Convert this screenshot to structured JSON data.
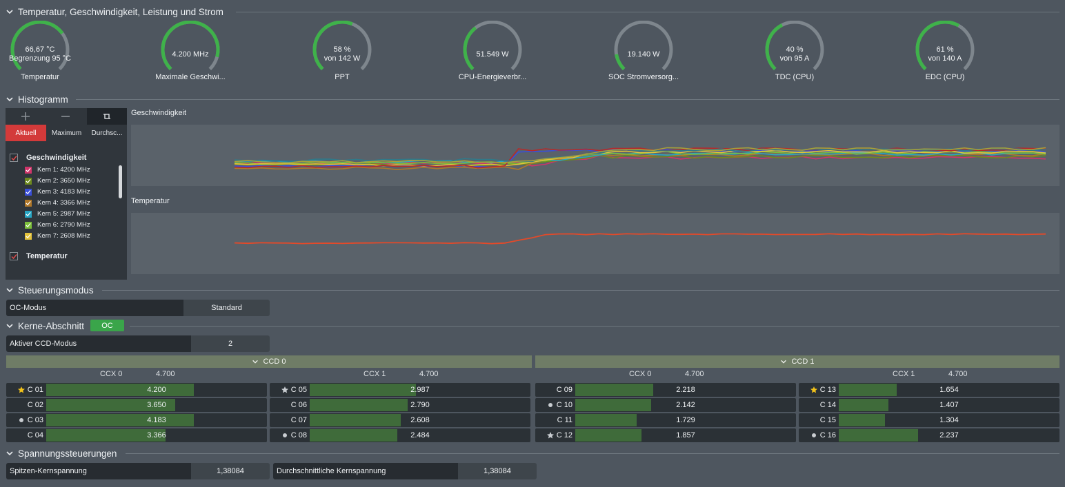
{
  "sections": {
    "temps": "Temperatur, Geschwindigkeit, Leistung und Strom",
    "histogram": "Histogramm",
    "control_mode": "Steuerungsmodus",
    "cores": "Kerne-Abschnitt",
    "voltage": "Spannungssteuerungen"
  },
  "gauges": [
    {
      "v1": "66,67 °C",
      "v2": "Begrenzung 95 °C",
      "label": "Temperatur",
      "level": 0.7
    },
    {
      "v1": "4.200  MHz",
      "v2": "",
      "label": "Maximale Geschwi...",
      "level": 0.89
    },
    {
      "v1": "58 %",
      "v2": "von 142 W",
      "label": "PPT",
      "level": 0.58
    },
    {
      "v1": "51.549 W",
      "v2": "",
      "label": "CPU-Energieverbr...",
      "level": 0.36
    },
    {
      "v1": "19.140 W",
      "v2": "",
      "label": "SOC Stromversorg...",
      "level": 0.13
    },
    {
      "v1": "40 %",
      "v2": "von 95 A",
      "label": "TDC (CPU)",
      "level": 0.4
    },
    {
      "v1": "61 %",
      "v2": "von 140 A",
      "label": "EDC (CPU)",
      "level": 0.61
    }
  ],
  "histogram": {
    "tab_aktuell": "Aktuell",
    "tab_maximum": "Maximum",
    "tab_durchschnitt": "Durchsc...",
    "group_speed": "Geschwindigkeit",
    "group_temp": "Temperatur",
    "plot_speed_title": "Geschwindigkeit",
    "plot_temp_title": "Temperatur",
    "kerne": [
      {
        "label": "Kern 1: 4200 MHz",
        "color": "#d0356a"
      },
      {
        "label": "Kern 2: 3650 MHz",
        "color": "#6e8a1e"
      },
      {
        "label": "Kern 3: 4183 MHz",
        "color": "#3a4fd8"
      },
      {
        "label": "Kern 4: 3366 MHz",
        "color": "#b0782a"
      },
      {
        "label": "Kern 5: 2987 MHz",
        "color": "#27a6c4"
      },
      {
        "label": "Kern 6: 2790 MHz",
        "color": "#7cbf3a"
      },
      {
        "label": "Kern 7: 2608 MHz",
        "color": "#e3c23a"
      }
    ]
  },
  "control_mode": {
    "label": "OC-Modus",
    "value": "Standard"
  },
  "cores_section": {
    "badge": "OC",
    "ccd_mode_label": "Aktiver CCD-Modus",
    "ccd_mode_value": "2",
    "ccd0": "CCD 0",
    "ccd1": "CCD 1",
    "ccx_groups": [
      {
        "name": "CCX 0",
        "max": "4.700",
        "cores": [
          {
            "name": "C 01",
            "value": "4.200",
            "mark": "star-gold",
            "level": 0.89
          },
          {
            "name": "C 02",
            "value": "3.650",
            "mark": "",
            "level": 0.78
          },
          {
            "name": "C 03",
            "value": "4.183",
            "mark": "dot",
            "level": 0.89
          },
          {
            "name": "C 04",
            "value": "3.366",
            "mark": "",
            "level": 0.72
          }
        ]
      },
      {
        "name": "CCX 1",
        "max": "4.700",
        "cores": [
          {
            "name": "C 05",
            "value": "2.987",
            "mark": "star-grey",
            "level": 0.64
          },
          {
            "name": "C 06",
            "value": "2.790",
            "mark": "",
            "level": 0.59
          },
          {
            "name": "C 07",
            "value": "2.608",
            "mark": "",
            "level": 0.55
          },
          {
            "name": "C 08",
            "value": "2.484",
            "mark": "dot",
            "level": 0.53
          }
        ]
      },
      {
        "name": "CCX 0",
        "max": "4.700",
        "cores": [
          {
            "name": "C 09",
            "value": "2.218",
            "mark": "",
            "level": 0.47
          },
          {
            "name": "C 10",
            "value": "2.142",
            "mark": "dot",
            "level": 0.46
          },
          {
            "name": "C 11",
            "value": "1.729",
            "mark": "",
            "level": 0.37
          },
          {
            "name": "C 12",
            "value": "1.857",
            "mark": "star-grey",
            "level": 0.4
          }
        ]
      },
      {
        "name": "CCX 1",
        "max": "4.700",
        "cores": [
          {
            "name": "C 13",
            "value": "1.654",
            "mark": "star-gold",
            "level": 0.35
          },
          {
            "name": "C 14",
            "value": "1.407",
            "mark": "",
            "level": 0.3
          },
          {
            "name": "C 15",
            "value": "1.304",
            "mark": "",
            "level": 0.28
          },
          {
            "name": "C 16",
            "value": "2.237",
            "mark": "dot",
            "level": 0.48
          }
        ]
      }
    ]
  },
  "voltage": {
    "peak_label": "Spitzen-Kernspannung",
    "peak_value": "1,38084",
    "avg_label": "Durchschnittliche Kernspannung",
    "avg_value": "1,38084"
  },
  "colors": {
    "accent_red": "#d33a3a",
    "gauge_green": "#3fb24a",
    "temp_line": "#e24a2a"
  }
}
